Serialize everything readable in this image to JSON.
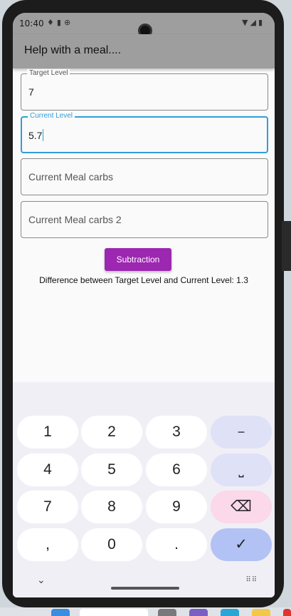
{
  "status_bar": {
    "time": "10:40",
    "left_icons": [
      "notification-icon",
      "sd-card-icon",
      "globe-icon"
    ],
    "right_icons": [
      "wifi-icon",
      "signal-icon",
      "battery-icon"
    ]
  },
  "app_bar": {
    "title": "Help with a meal...."
  },
  "fields": {
    "target_level": {
      "label": "Target Level",
      "value": "7"
    },
    "current_level": {
      "label": "Current Level",
      "value": "5.7"
    },
    "meal_carbs": {
      "placeholder": "Current Meal carbs"
    },
    "meal_carbs_2": {
      "placeholder": "Current Meal carbs 2"
    }
  },
  "subtract_button": {
    "label": "Subtraction",
    "color": "#9c27b0"
  },
  "result_text": "Difference between Target Level and Current Level: 1.3",
  "keyboard": {
    "keys": {
      "k1": "1",
      "k2": "2",
      "k3": "3",
      "minus": "−",
      "k4": "4",
      "k5": "5",
      "k6": "6",
      "space": "⎵",
      "k7": "7",
      "k8": "8",
      "k9": "9",
      "backspace": "⌫",
      "comma": ",",
      "k0": "0",
      "period": ".",
      "done": "✓"
    }
  },
  "colors": {
    "accent_focus": "#2f9fd6",
    "app_bar": "#9e9e9e"
  }
}
